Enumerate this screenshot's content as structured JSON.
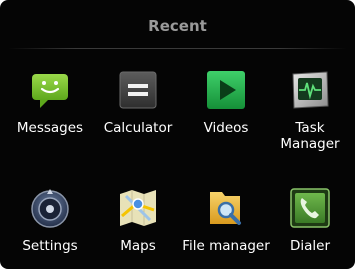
{
  "header": {
    "title": "Recent"
  },
  "apps": [
    {
      "label": "Messages",
      "icon": "messages-icon"
    },
    {
      "label": "Calculator",
      "icon": "calculator-icon"
    },
    {
      "label": "Videos",
      "icon": "videos-icon"
    },
    {
      "label": "Task\nManager",
      "icon": "task-manager-icon"
    },
    {
      "label": "Settings",
      "icon": "settings-icon"
    },
    {
      "label": "Maps",
      "icon": "maps-icon"
    },
    {
      "label": "File manager",
      "icon": "file-manager-icon"
    },
    {
      "label": "Dialer",
      "icon": "dialer-icon"
    }
  ],
  "colors": {
    "background": "#050505",
    "title": "#9a9a9a",
    "label": "#ffffff",
    "messages_green": "#7cc62a",
    "videos_green": "#22b04a",
    "dialer_green": "#5a9a3a"
  }
}
